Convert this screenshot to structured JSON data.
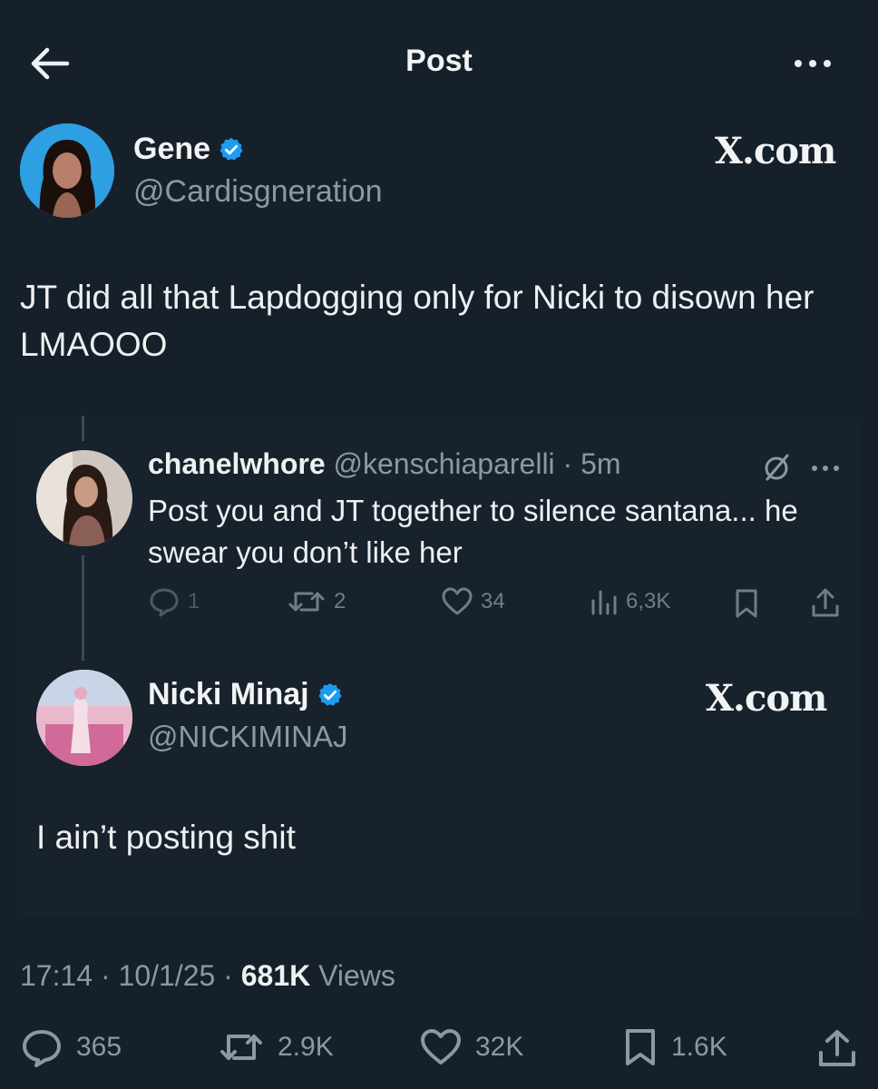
{
  "header": {
    "title": "Post",
    "back_icon": "arrow-left-icon",
    "more_icon": "more-horizontal-icon"
  },
  "post": {
    "author": {
      "name": "Gene",
      "handle": "@Cardisgneration",
      "verified": true
    },
    "watermark": "X.com",
    "text": "JT did all that Lapdogging only for Nicki to disown her LMAOOO",
    "timestamp": "17:14",
    "date": "10/1/25",
    "views_count": "681K",
    "views_label": "Views",
    "actions": {
      "replies": "365",
      "reposts": "2.9K",
      "likes": "32K",
      "bookmarks": "1.6K"
    }
  },
  "quoted": {
    "reply": {
      "name": "chanelwhore",
      "handle": "@kenschiaparelli",
      "separator": " · ",
      "time": "5m",
      "text": "Post you and JT together to silence santana... he swear you don’t like her",
      "actions": {
        "replies": "1",
        "reposts": "2",
        "likes": "34",
        "views": "6,3K"
      }
    },
    "main": {
      "name": "Nicki Minaj",
      "handle": "@NICKIMINAJ",
      "verified": true,
      "watermark": "X.com",
      "text": "I ain’t posting shit"
    }
  },
  "colors": {
    "background": "#16202b",
    "text": "#e7e9ea",
    "muted": "#8b98a5",
    "verified": "#1d9bf0"
  }
}
